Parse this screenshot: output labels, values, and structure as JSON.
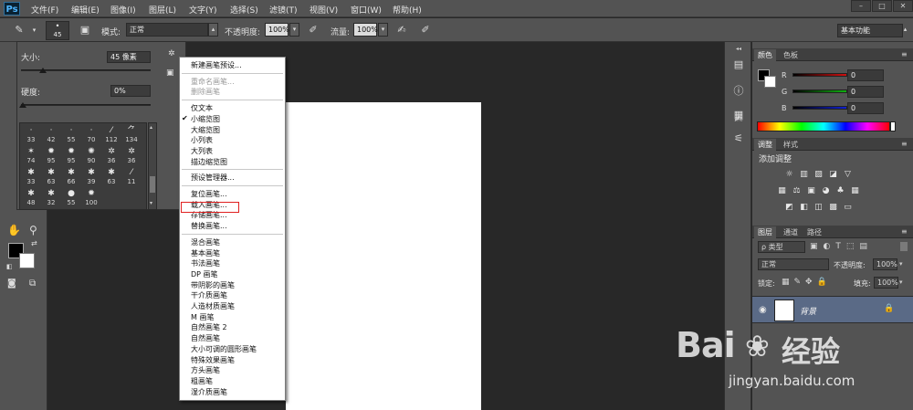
{
  "app": {
    "logo": "Ps",
    "menu": [
      "文件(F)",
      "编辑(E)",
      "图像(I)",
      "图层(L)",
      "文字(Y)",
      "选择(S)",
      "滤镜(T)",
      "视图(V)",
      "窗口(W)",
      "帮助(H)"
    ],
    "window_controls": [
      "–",
      "□",
      "✕"
    ]
  },
  "options_bar": {
    "brush_size": "45",
    "mode_label": "模式:",
    "mode_value": "正常",
    "opacity_label": "不透明度:",
    "opacity_value": "100%",
    "flow_label": "流量:",
    "flow_value": "100%",
    "workspace": "基本功能"
  },
  "brush_picker": {
    "size_label": "大小:",
    "size_value": "45 像素",
    "hardness_label": "硬度:",
    "hardness_value": "0%",
    "size_fraction": 0.17,
    "hardness_fraction": 0.0,
    "brushes": [
      {
        "shape": "·",
        "num": "33"
      },
      {
        "shape": "·",
        "num": "42"
      },
      {
        "shape": "·",
        "num": "55"
      },
      {
        "shape": "·",
        "num": "70"
      },
      {
        "shape": "⁄",
        "num": "112"
      },
      {
        "shape": "⺈",
        "num": "134"
      },
      {
        "shape": "✶",
        "num": "74"
      },
      {
        "shape": "✹",
        "num": "95"
      },
      {
        "shape": "✹",
        "num": "95"
      },
      {
        "shape": "✺",
        "num": "90"
      },
      {
        "shape": "✲",
        "num": "36"
      },
      {
        "shape": "✲",
        "num": "36"
      },
      {
        "shape": "✱",
        "num": "33"
      },
      {
        "shape": "✱",
        "num": "63"
      },
      {
        "shape": "✱",
        "num": "66"
      },
      {
        "shape": "✱",
        "num": "39"
      },
      {
        "shape": "✱",
        "num": "63"
      },
      {
        "shape": "⁄",
        "num": "11"
      },
      {
        "shape": "✱",
        "num": "48"
      },
      {
        "shape": "✱",
        "num": "32"
      },
      {
        "shape": "●",
        "num": "55"
      },
      {
        "shape": "✹",
        "num": "100"
      }
    ]
  },
  "context_menu": {
    "groups": [
      [
        {
          "label": "新建画笔预设...",
          "disabled": false
        }
      ],
      [
        {
          "label": "重命名画笔...",
          "disabled": true
        },
        {
          "label": "删除画笔",
          "disabled": true
        }
      ],
      [
        {
          "label": "仅文本",
          "checked": false
        },
        {
          "label": "小缩览图",
          "checked": true
        },
        {
          "label": "大缩览图",
          "checked": false
        },
        {
          "label": "小列表",
          "checked": false
        },
        {
          "label": "大列表",
          "checked": false
        },
        {
          "label": "描边缩览图",
          "checked": false
        }
      ],
      [
        {
          "label": "预设管理器..."
        }
      ],
      [
        {
          "label": "复位画笔..."
        },
        {
          "label": "载入画笔..."
        },
        {
          "label": "存储画笔..."
        },
        {
          "label": "替换画笔..."
        }
      ],
      [
        {
          "label": "混合画笔"
        },
        {
          "label": "基本画笔"
        },
        {
          "label": "书法画笔"
        },
        {
          "label": "DP 画笔"
        },
        {
          "label": "带阴影的画笔"
        },
        {
          "label": "干介质画笔"
        },
        {
          "label": "人造材质画笔"
        },
        {
          "label": "M 画笔"
        },
        {
          "label": "自然画笔 2"
        },
        {
          "label": "自然画笔"
        },
        {
          "label": "大小可调的圆形画笔"
        },
        {
          "label": "特殊效果画笔"
        },
        {
          "label": "方头画笔"
        },
        {
          "label": "粗画笔"
        },
        {
          "label": "湿介质画笔"
        }
      ]
    ]
  },
  "color_panel": {
    "tabs": [
      "颜色",
      "色板"
    ],
    "channels": [
      {
        "label": "R",
        "value": "0",
        "color": "#d01010"
      },
      {
        "label": "G",
        "value": "0",
        "color": "#10b010"
      },
      {
        "label": "B",
        "value": "0",
        "color": "#1020d0"
      }
    ]
  },
  "adjust_panel": {
    "tabs": [
      "调整",
      "样式"
    ],
    "title": "添加调整",
    "icons_row1": [
      "☼",
      "▥",
      "▨",
      "◪",
      "▽"
    ],
    "icons_row2": [
      "▦",
      "⚖",
      "▣",
      "◕",
      "♣",
      "▦"
    ],
    "icons_row3": [
      "◩",
      "◧",
      "◫",
      "▩",
      "▭"
    ]
  },
  "layers_panel": {
    "tabs": [
      "图层",
      "通道",
      "路径"
    ],
    "kind_filter": "ρ 类型",
    "blend_mode": "正常",
    "opacity_label": "不透明度:",
    "opacity_value": "100%",
    "lock_label": "锁定:",
    "fill_label": "填充:",
    "fill_value": "100%",
    "layer_name": "背景"
  },
  "watermark": {
    "brand": "Bai",
    "brand2": "经验",
    "url": "jingyan.baidu.com"
  }
}
